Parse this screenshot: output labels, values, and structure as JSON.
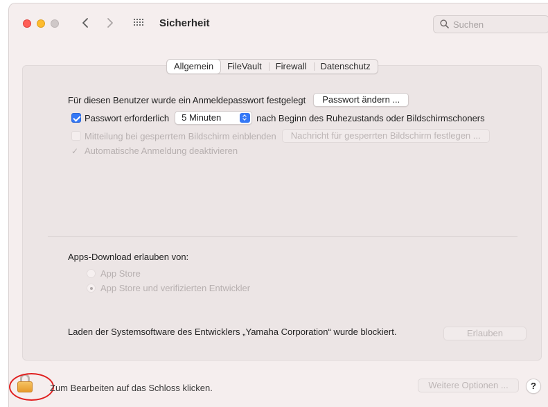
{
  "window": {
    "title": "Sicherheit",
    "search": {
      "placeholder": "Suchen",
      "value": ""
    }
  },
  "tabs": [
    {
      "label": "Allgemein",
      "active": true
    },
    {
      "label": "FileVault",
      "active": false
    },
    {
      "label": "Firewall",
      "active": false
    },
    {
      "label": "Datenschutz",
      "active": false
    }
  ],
  "general": {
    "password_set_label": "Für diesen Benutzer wurde ein Anmeldepasswort festgelegt",
    "change_password_button": "Passwort ändern ...",
    "require_password": {
      "label": "Passwort erforderlich",
      "checked": true,
      "interval_value": "5 Minuten",
      "suffix": "nach Beginn des Ruhezustands oder Bildschirmschoners"
    },
    "lock_message": {
      "label": "Mitteilung bei gesperrtem Bildschirm einblenden",
      "checked": false,
      "enabled": false,
      "button": "Nachricht für gesperrten Bildschirm festlegen ..."
    },
    "disable_autologin": {
      "label": "Automatische Anmeldung deaktivieren",
      "checked": true,
      "enabled": false
    }
  },
  "downloads": {
    "label": "Apps-Download erlauben von:",
    "options": [
      {
        "label": "App Store",
        "selected": false
      },
      {
        "label": "App Store und verifizierten Entwickler",
        "selected": true
      }
    ]
  },
  "blocked": {
    "text": "Laden der Systemsoftware des Entwicklers „Yamaha Corporation“ wurde blockiert.",
    "button": "Erlauben"
  },
  "footer": {
    "lock_text": "Zum Bearbeiten auf das Schloss klicken.",
    "more_options": "Weitere Optionen ...",
    "help": "?"
  },
  "colors": {
    "accent": "#3478f6",
    "window_bg": "#f5eeee",
    "annotation_circle": "#e02020"
  }
}
